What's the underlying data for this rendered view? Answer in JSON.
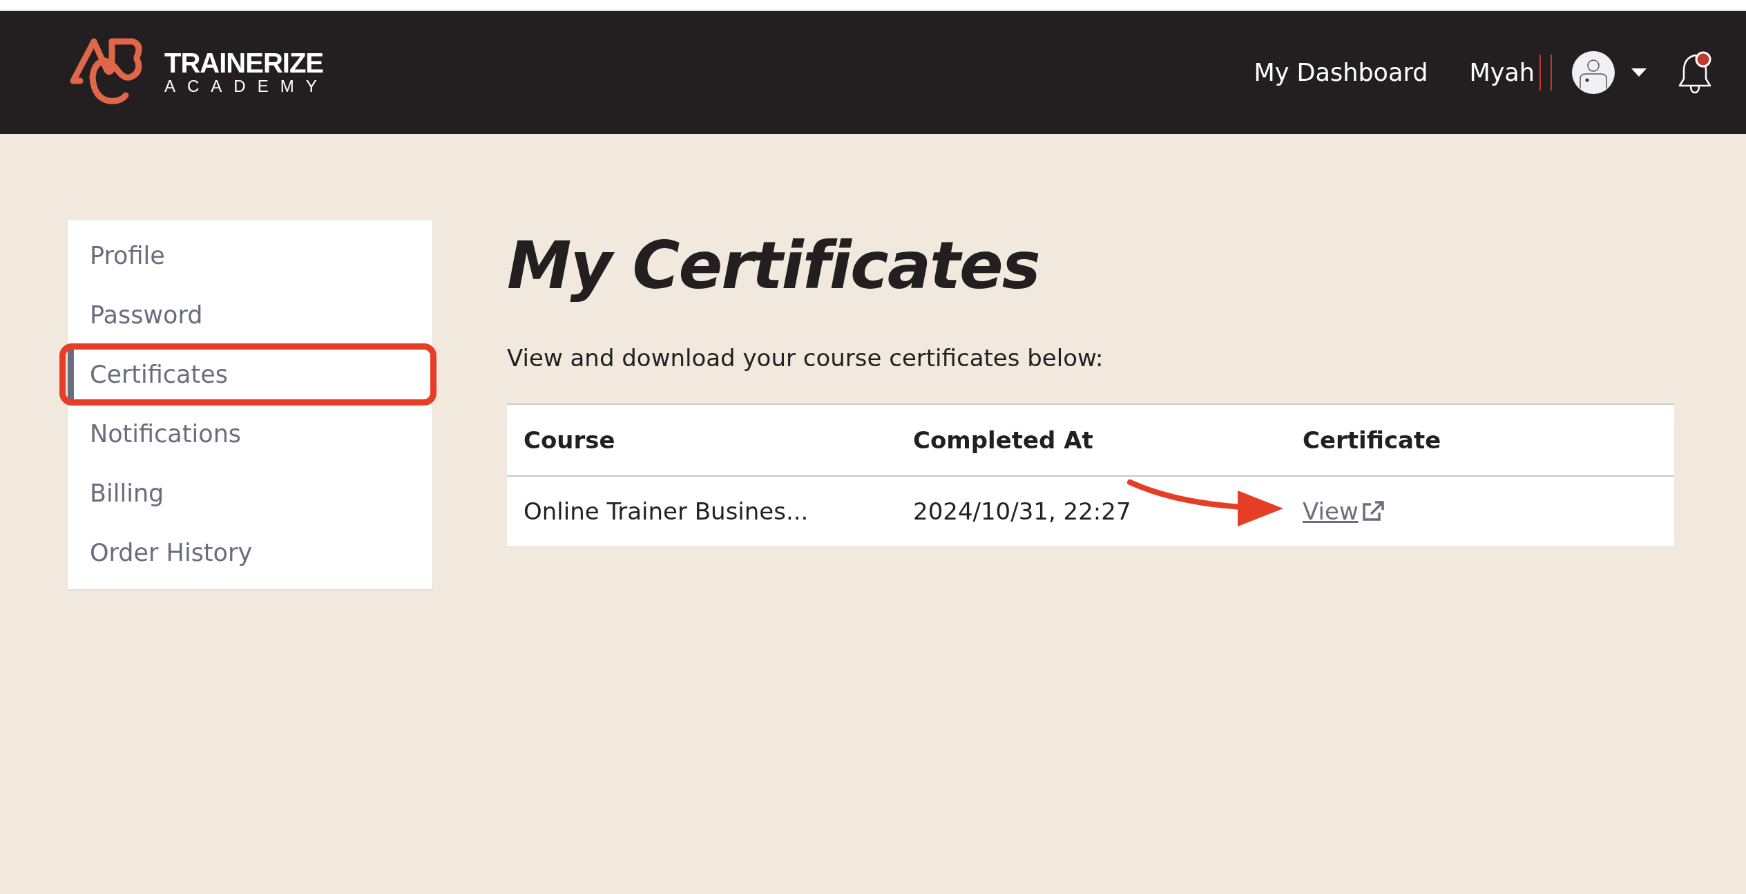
{
  "header": {
    "logo": {
      "brand": "TRAINERIZE",
      "subtitle": "ACADEMY"
    },
    "nav_link": "My Dashboard",
    "user_name": "Myah",
    "notification_badge": true
  },
  "sidebar": {
    "items": [
      {
        "label": "Profile",
        "selected": false,
        "highlighted": false
      },
      {
        "label": "Password",
        "selected": false,
        "highlighted": false
      },
      {
        "label": "Certificates",
        "selected": true,
        "highlighted": true
      },
      {
        "label": "Notifications",
        "selected": false,
        "highlighted": false
      },
      {
        "label": "Billing",
        "selected": false,
        "highlighted": false
      },
      {
        "label": "Order History",
        "selected": false,
        "highlighted": false
      }
    ]
  },
  "main": {
    "title": "My Certificates",
    "description": "View and download your course certificates below:",
    "table": {
      "columns": [
        "Course",
        "Completed At",
        "Certificate"
      ],
      "rows": [
        {
          "course": "Online Trainer Busines...",
          "completed_at": "2024/10/31, 22:27",
          "certificate_link": "View",
          "pointed_at": true
        }
      ]
    }
  }
}
